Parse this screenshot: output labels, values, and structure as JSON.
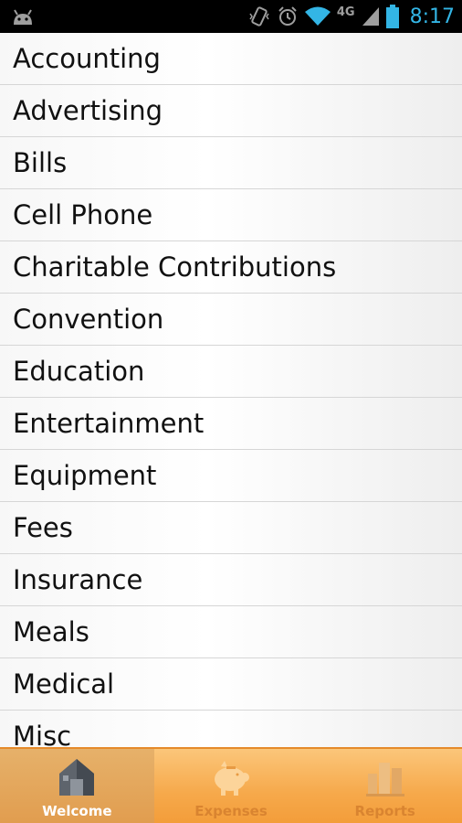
{
  "status_bar": {
    "network": "4G",
    "time": "8:17",
    "icons": [
      "android-icon",
      "vibrate-icon",
      "alarm-icon",
      "wifi-icon",
      "signal-icon",
      "battery-icon"
    ]
  },
  "categories": [
    "Accounting",
    "Advertising",
    "Bills",
    "Cell Phone",
    "Charitable Contributions",
    "Convention",
    "Education",
    "Entertainment",
    "Equipment",
    "Fees",
    "Insurance",
    "Meals",
    "Medical",
    "Misc"
  ],
  "tabs": [
    {
      "label": "Welcome",
      "icon": "house-icon",
      "active": true
    },
    {
      "label": "Expenses",
      "icon": "piggy-bank-icon",
      "active": false
    },
    {
      "label": "Reports",
      "icon": "bar-chart-icon",
      "active": false
    }
  ],
  "colors": {
    "status_accent": "#33b5e5",
    "tab_bar": "#f6a94b",
    "tab_label_inactive": "#d98430"
  }
}
